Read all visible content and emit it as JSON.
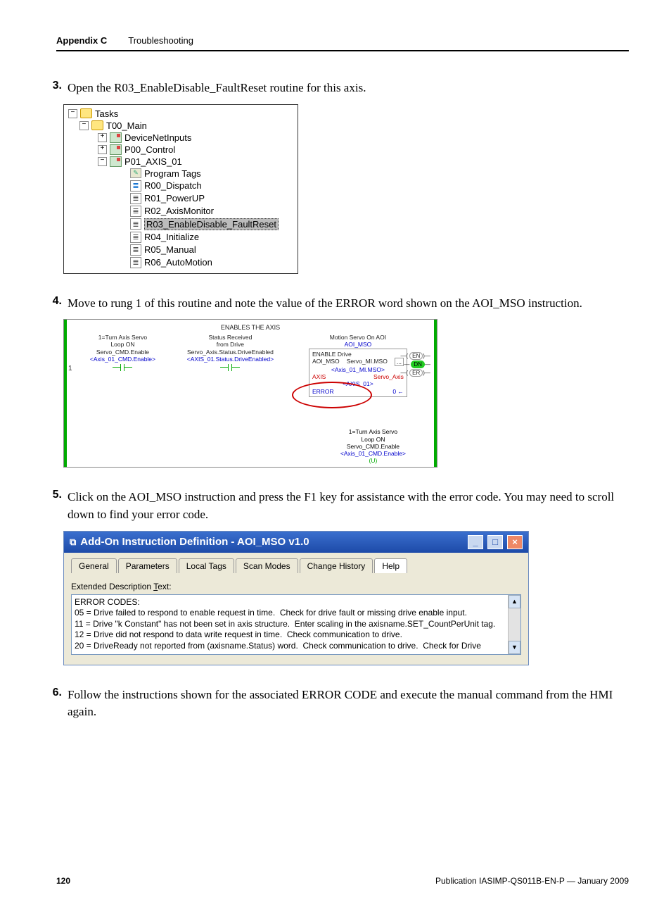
{
  "header": {
    "appendix": "Appendix C",
    "title": "Troubleshooting"
  },
  "steps": {
    "s3": {
      "num": "3.",
      "text": "Open the R03_EnableDisable_FaultReset routine for this axis."
    },
    "s4": {
      "num": "4.",
      "text": "Move to rung 1 of this routine and note the value of the ERROR word shown on the AOI_MSO instruction."
    },
    "s5": {
      "num": "5.",
      "text": "Click on the AOI_MSO instruction and press the F1 key for assistance with the error code. You may need to scroll down to find your error code."
    },
    "s6": {
      "num": "6.",
      "text": "Follow the instructions shown for the associated ERROR CODE and execute the manual command from the HMI again."
    }
  },
  "tree": {
    "tasks": "Tasks",
    "t00": "T00_Main",
    "devnet": "DeviceNetInputs",
    "p00": "P00_Control",
    "p01": "P01_AXIS_01",
    "ptags": "Program Tags",
    "r00": "R00_Dispatch",
    "r01": "R01_PowerUP",
    "r02": "R02_AxisMonitor",
    "r03": "R03_EnableDisable_FaultReset",
    "r04": "R04_Initialize",
    "r05": "R05_Manual",
    "r06": "R06_AutoMotion"
  },
  "rung": {
    "num": "1",
    "title1": "ENABLES THE AXIS",
    "c1a": "1=Turn Axis Servo",
    "c1b": "Loop ON",
    "c1c": "Servo_CMD.Enable",
    "c1d": "<Axis_01_CMD.Enable>",
    "c2a": "Status Received",
    "c2b": "from Drive",
    "c2c": "Servo_Axis.Status.DriveEnabled",
    "c2d": "<AXIS_01.Status.DriveEnabled>",
    "aoi_title": "Motion Servo On AOI",
    "aoi_sub": "AOI_MSO",
    "aoi_enable": "ENABLE Drive",
    "aoi_r1a": "AOI_MSO",
    "aoi_r1b": "Servo_MI.MSO",
    "aoi_r1c": "...",
    "aoi_r2": "<Axis_01_MI.MSO>",
    "aoi_r3a": "AXIS",
    "aoi_r3b": "Servo_Axis",
    "aoi_r4": "<AXIS_01>",
    "aoi_r5a": "ERROR",
    "aoi_r5b": "0",
    "pin_en": "EN",
    "pin_dn": "DN",
    "pin_er": "ER",
    "b1": "1=Turn Axis Servo",
    "b2": "Loop ON",
    "b3": "Servo_CMD.Enable",
    "b4": "<Axis_01_CMD.Enable>",
    "b5": "(U)"
  },
  "win": {
    "title": "Add-On Instruction Definition - AOI_MSO v1.0",
    "tabs": {
      "general": "General",
      "params": "Parameters",
      "local": "Local Tags",
      "scan": "Scan Modes",
      "change": "Change History",
      "help": "Help"
    },
    "label_pre": "Extended Description ",
    "label_u": "T",
    "label_post": "ext:",
    "desc": "ERROR CODES:\n05 = Drive failed to respond to enable request in time.  Check for drive fault or missing drive enable input.\n11 = Drive \"k Constant\" has not been set in axis structure.  Enter scaling in the axisname.SET_CountPerUnit tag.\n12 = Drive did not respond to data write request in time.  Check communication to drive.\n20 = DriveReady not reported from (axisname.Status) word.  Check communication to drive.  Check for Drive"
  },
  "footer": {
    "page": "120",
    "pub": "Publication IASIMP-QS011B-EN-P — January 2009"
  }
}
